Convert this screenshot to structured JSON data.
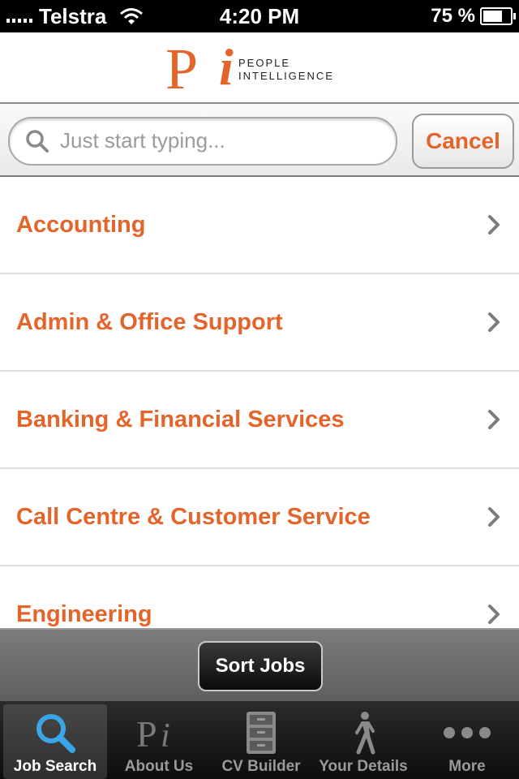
{
  "status_bar": {
    "carrier": "Telstra",
    "time": "4:20 PM",
    "battery_text": "75 %",
    "battery_level": 0.75
  },
  "header": {
    "logo_letters": "Pi",
    "logo_line1": "PEOPLE",
    "logo_line2": "INTELLIGENCE"
  },
  "search": {
    "placeholder": "Just start typing...",
    "value": "",
    "cancel_label": "Cancel"
  },
  "categories": [
    {
      "label": "Accounting"
    },
    {
      "label": "Admin & Office Support"
    },
    {
      "label": "Banking & Financial Services"
    },
    {
      "label": "Call Centre & Customer Service"
    },
    {
      "label": "Engineering"
    }
  ],
  "sort": {
    "label": "Sort Jobs"
  },
  "tabs": [
    {
      "label": "Job Search",
      "icon": "magnifier-icon",
      "active": true
    },
    {
      "label": "About Us",
      "icon": "pi-logo-icon",
      "active": false
    },
    {
      "label": "CV Builder",
      "icon": "file-cabinet-icon",
      "active": false
    },
    {
      "label": "Your Details",
      "icon": "walking-person-icon",
      "active": false
    },
    {
      "label": "More",
      "icon": "more-dots-icon",
      "active": false
    }
  ],
  "colors": {
    "accent": "#e4652b",
    "tab_active": "#3aa6e8"
  }
}
